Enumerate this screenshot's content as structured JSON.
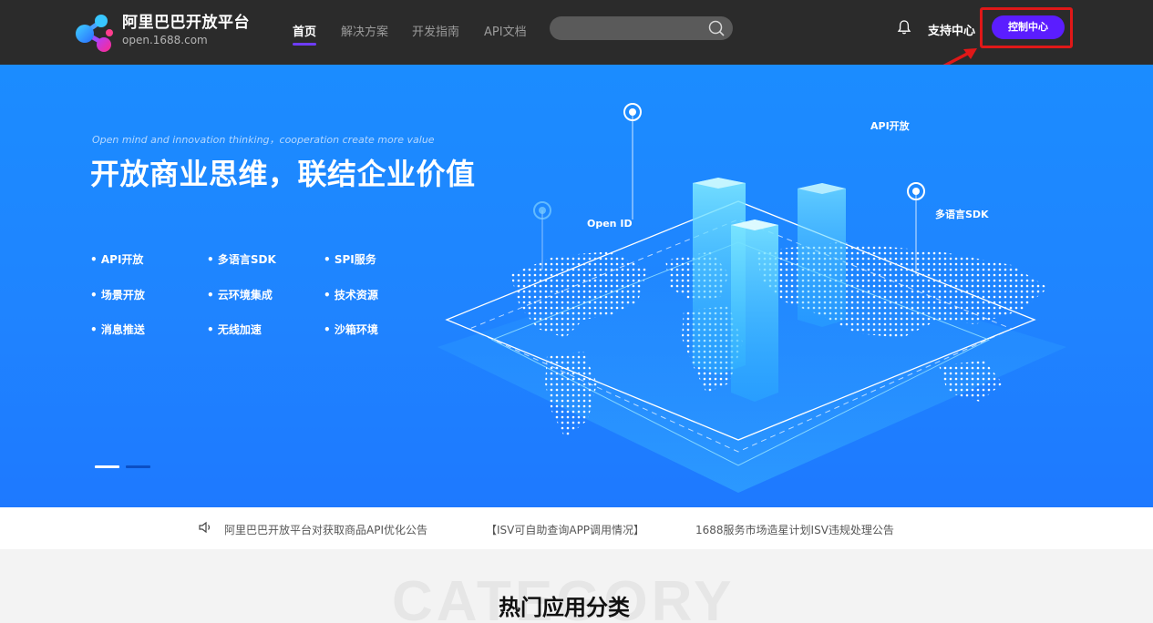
{
  "header": {
    "brand_name": "阿里巴巴开放平台",
    "brand_domain": "open.1688.com",
    "nav": [
      {
        "label": "首页",
        "active": true
      },
      {
        "label": "解决方案",
        "active": false
      },
      {
        "label": "开发指南",
        "active": false
      },
      {
        "label": "API文档",
        "active": false
      }
    ],
    "search": {
      "placeholder": "",
      "value": ""
    },
    "support_label": "支持中心",
    "console_label": "控制中心"
  },
  "banner": {
    "tagline": "Open mind and innovation thinking，cooperation create more value",
    "headline": "开放商业思维，联结企业价值",
    "features": [
      "API开放",
      "多语言SDK",
      "SPI服务",
      "场景开放",
      "云环境集成",
      "技术资源",
      "消息推送",
      "无线加速",
      "沙箱环境"
    ],
    "art_labels": {
      "open_id": "Open ID",
      "api": "API开放",
      "sdk": "多语言SDK"
    },
    "carousel": {
      "total": 2,
      "active": 1
    }
  },
  "notices": [
    "阿里巴巴开放平台对获取商品API优化公告",
    "【ISV可自助查询APP调用情况】",
    "1688服务市场造星计划ISV违规处理公告"
  ],
  "category": {
    "watermark": "CATEGORY",
    "title": "热门应用分类"
  },
  "colors": {
    "topbar": "#2b2b2b",
    "accent": "#5b1dff",
    "banner": "#1f84ff",
    "annotation": "#e01818"
  },
  "icons": {
    "logo": "molecule-logo-icon",
    "search": "search-icon",
    "bell": "bell-icon",
    "speaker": "speaker-icon",
    "arrow": "annotation-arrow-icon"
  }
}
